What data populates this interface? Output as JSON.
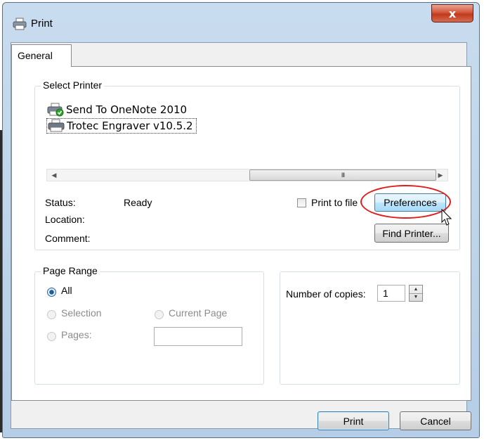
{
  "window": {
    "title": "Print",
    "close_glyph": "x"
  },
  "tabs": [
    {
      "label": "General",
      "active": true
    }
  ],
  "select_printer": {
    "group_label": "Select Printer",
    "printers": [
      {
        "name": "Send To OneNote 2010",
        "icon": "onenote-printer-icon",
        "selected": false
      },
      {
        "name": "Trotec Engraver v10.5.2",
        "icon": "printer-icon",
        "selected": true
      }
    ],
    "scroll_grip": "III",
    "status_label": "Status:",
    "status_value": "Ready",
    "location_label": "Location:",
    "location_value": "",
    "comment_label": "Comment:",
    "comment_value": "",
    "print_to_file_label": "Print to file",
    "print_to_file_checked": false,
    "preferences_label": "Preferences",
    "find_printer_label": "Find Printer..."
  },
  "page_range": {
    "group_label": "Page Range",
    "options": [
      {
        "label": "All",
        "checked": true,
        "enabled": true
      },
      {
        "label": "Selection",
        "checked": false,
        "enabled": false
      },
      {
        "label": "Current Page",
        "checked": false,
        "enabled": false
      },
      {
        "label": "Pages:",
        "checked": false,
        "enabled": false
      }
    ],
    "pages_value": ""
  },
  "copies": {
    "label": "Number of copies:",
    "value": "1"
  },
  "footer": {
    "print_label": "Print",
    "cancel_label": "Cancel"
  },
  "colors": {
    "annotation": "#e01b1b",
    "focus_border": "#3c7fb1"
  }
}
